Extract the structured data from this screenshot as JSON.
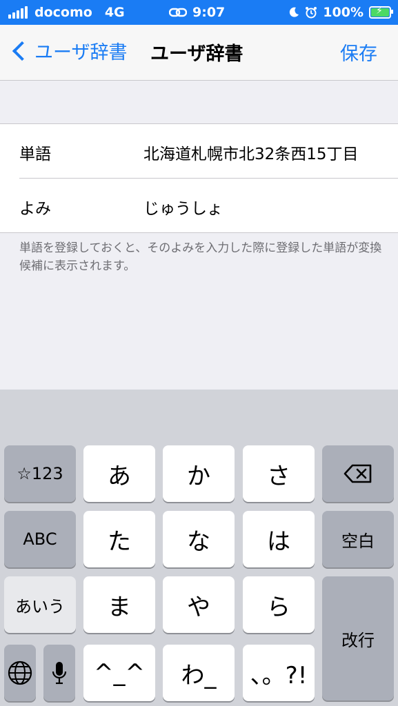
{
  "status_bar": {
    "carrier": "docomo",
    "network": "4G",
    "time": "9:07",
    "battery_percent": "100%",
    "icons": [
      "signal-bars-icon",
      "link-icon",
      "moon-icon",
      "alarm-icon",
      "battery-charging-icon"
    ]
  },
  "nav": {
    "back_label": "ユーザ辞書",
    "title": "ユーザ辞書",
    "save_label": "保存"
  },
  "form": {
    "word_label": "単語",
    "word_value": "北海道札幌市北32条西15丁目",
    "reading_label": "よみ",
    "reading_value": "じゅうしょ"
  },
  "hint": "単語を登録しておくと、そのよみを入力した際に登録した単語が変換候補に表示されます。",
  "keyboard": {
    "keys": {
      "symbols": "☆123",
      "a": "あ",
      "ka": "か",
      "sa": "さ",
      "abc": "ABC",
      "ta": "た",
      "na": "な",
      "ha": "は",
      "space": "空白",
      "aiu": "あいう",
      "ma": "ま",
      "ya": "や",
      "ra": "ら",
      "enter": "改行",
      "emoticon": "^_^",
      "wa": "わ_",
      "punct": "、。?!"
    },
    "icons": [
      "delete-icon",
      "globe-icon",
      "microphone-icon"
    ]
  },
  "colors": {
    "accent": "#1a7cf4",
    "status_bar_bg": "#1a7cf4",
    "battery_fill": "#4cd964",
    "page_bg": "#efeff4",
    "keyboard_bg": "#d1d3d9",
    "dark_key": "#abafb9"
  }
}
